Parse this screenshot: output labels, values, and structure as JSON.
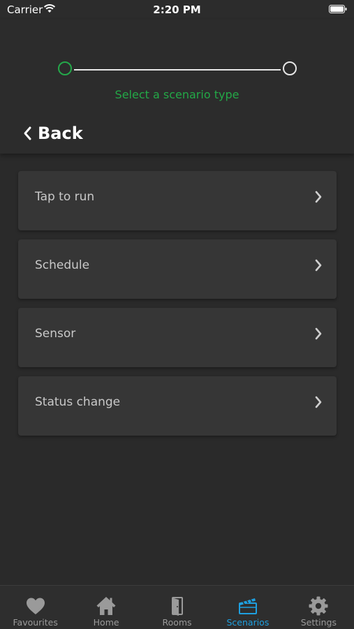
{
  "status_bar": {
    "carrier": "Carrier",
    "time": "2:20 PM"
  },
  "stepper": {
    "current_step": 1,
    "total_steps": 2,
    "label": "Select a scenario type",
    "active_color": "#24a84a",
    "inactive_color": "#e6e6e6"
  },
  "nav": {
    "back_label": "Back"
  },
  "scenario_types": [
    {
      "label": "Tap to run"
    },
    {
      "label": "Schedule"
    },
    {
      "label": "Sensor"
    },
    {
      "label": "Status change"
    }
  ],
  "tab_bar": {
    "active_color": "#1ea0e0",
    "tabs": [
      {
        "label": "Favourites",
        "icon": "heart-icon"
      },
      {
        "label": "Home",
        "icon": "house-icon"
      },
      {
        "label": "Rooms",
        "icon": "door-icon"
      },
      {
        "label": "Scenarios",
        "icon": "clapperboard-icon",
        "active": true
      },
      {
        "label": "Settings",
        "icon": "gear-icon"
      }
    ]
  }
}
